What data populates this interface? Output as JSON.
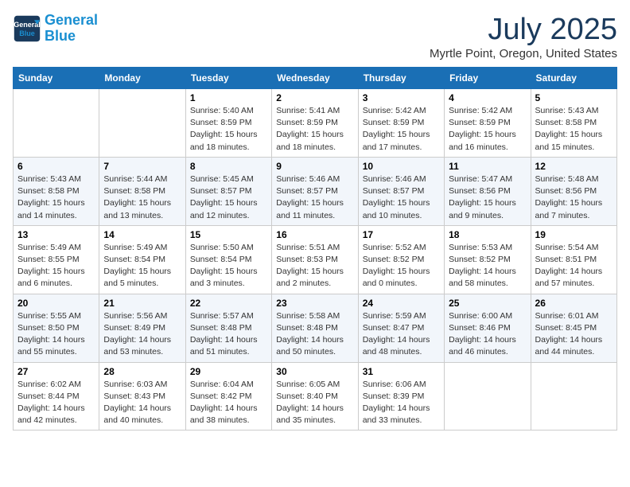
{
  "header": {
    "logo_line1": "General",
    "logo_line2": "Blue",
    "title": "July 2025",
    "subtitle": "Myrtle Point, Oregon, United States"
  },
  "days_of_week": [
    "Sunday",
    "Monday",
    "Tuesday",
    "Wednesday",
    "Thursday",
    "Friday",
    "Saturday"
  ],
  "weeks": [
    [
      {
        "day": "",
        "info": ""
      },
      {
        "day": "",
        "info": ""
      },
      {
        "day": "1",
        "info": "Sunrise: 5:40 AM\nSunset: 8:59 PM\nDaylight: 15 hours\nand 18 minutes."
      },
      {
        "day": "2",
        "info": "Sunrise: 5:41 AM\nSunset: 8:59 PM\nDaylight: 15 hours\nand 18 minutes."
      },
      {
        "day": "3",
        "info": "Sunrise: 5:42 AM\nSunset: 8:59 PM\nDaylight: 15 hours\nand 17 minutes."
      },
      {
        "day": "4",
        "info": "Sunrise: 5:42 AM\nSunset: 8:59 PM\nDaylight: 15 hours\nand 16 minutes."
      },
      {
        "day": "5",
        "info": "Sunrise: 5:43 AM\nSunset: 8:58 PM\nDaylight: 15 hours\nand 15 minutes."
      }
    ],
    [
      {
        "day": "6",
        "info": "Sunrise: 5:43 AM\nSunset: 8:58 PM\nDaylight: 15 hours\nand 14 minutes."
      },
      {
        "day": "7",
        "info": "Sunrise: 5:44 AM\nSunset: 8:58 PM\nDaylight: 15 hours\nand 13 minutes."
      },
      {
        "day": "8",
        "info": "Sunrise: 5:45 AM\nSunset: 8:57 PM\nDaylight: 15 hours\nand 12 minutes."
      },
      {
        "day": "9",
        "info": "Sunrise: 5:46 AM\nSunset: 8:57 PM\nDaylight: 15 hours\nand 11 minutes."
      },
      {
        "day": "10",
        "info": "Sunrise: 5:46 AM\nSunset: 8:57 PM\nDaylight: 15 hours\nand 10 minutes."
      },
      {
        "day": "11",
        "info": "Sunrise: 5:47 AM\nSunset: 8:56 PM\nDaylight: 15 hours\nand 9 minutes."
      },
      {
        "day": "12",
        "info": "Sunrise: 5:48 AM\nSunset: 8:56 PM\nDaylight: 15 hours\nand 7 minutes."
      }
    ],
    [
      {
        "day": "13",
        "info": "Sunrise: 5:49 AM\nSunset: 8:55 PM\nDaylight: 15 hours\nand 6 minutes."
      },
      {
        "day": "14",
        "info": "Sunrise: 5:49 AM\nSunset: 8:54 PM\nDaylight: 15 hours\nand 5 minutes."
      },
      {
        "day": "15",
        "info": "Sunrise: 5:50 AM\nSunset: 8:54 PM\nDaylight: 15 hours\nand 3 minutes."
      },
      {
        "day": "16",
        "info": "Sunrise: 5:51 AM\nSunset: 8:53 PM\nDaylight: 15 hours\nand 2 minutes."
      },
      {
        "day": "17",
        "info": "Sunrise: 5:52 AM\nSunset: 8:52 PM\nDaylight: 15 hours\nand 0 minutes."
      },
      {
        "day": "18",
        "info": "Sunrise: 5:53 AM\nSunset: 8:52 PM\nDaylight: 14 hours\nand 58 minutes."
      },
      {
        "day": "19",
        "info": "Sunrise: 5:54 AM\nSunset: 8:51 PM\nDaylight: 14 hours\nand 57 minutes."
      }
    ],
    [
      {
        "day": "20",
        "info": "Sunrise: 5:55 AM\nSunset: 8:50 PM\nDaylight: 14 hours\nand 55 minutes."
      },
      {
        "day": "21",
        "info": "Sunrise: 5:56 AM\nSunset: 8:49 PM\nDaylight: 14 hours\nand 53 minutes."
      },
      {
        "day": "22",
        "info": "Sunrise: 5:57 AM\nSunset: 8:48 PM\nDaylight: 14 hours\nand 51 minutes."
      },
      {
        "day": "23",
        "info": "Sunrise: 5:58 AM\nSunset: 8:48 PM\nDaylight: 14 hours\nand 50 minutes."
      },
      {
        "day": "24",
        "info": "Sunrise: 5:59 AM\nSunset: 8:47 PM\nDaylight: 14 hours\nand 48 minutes."
      },
      {
        "day": "25",
        "info": "Sunrise: 6:00 AM\nSunset: 8:46 PM\nDaylight: 14 hours\nand 46 minutes."
      },
      {
        "day": "26",
        "info": "Sunrise: 6:01 AM\nSunset: 8:45 PM\nDaylight: 14 hours\nand 44 minutes."
      }
    ],
    [
      {
        "day": "27",
        "info": "Sunrise: 6:02 AM\nSunset: 8:44 PM\nDaylight: 14 hours\nand 42 minutes."
      },
      {
        "day": "28",
        "info": "Sunrise: 6:03 AM\nSunset: 8:43 PM\nDaylight: 14 hours\nand 40 minutes."
      },
      {
        "day": "29",
        "info": "Sunrise: 6:04 AM\nSunset: 8:42 PM\nDaylight: 14 hours\nand 38 minutes."
      },
      {
        "day": "30",
        "info": "Sunrise: 6:05 AM\nSunset: 8:40 PM\nDaylight: 14 hours\nand 35 minutes."
      },
      {
        "day": "31",
        "info": "Sunrise: 6:06 AM\nSunset: 8:39 PM\nDaylight: 14 hours\nand 33 minutes."
      },
      {
        "day": "",
        "info": ""
      },
      {
        "day": "",
        "info": ""
      }
    ]
  ]
}
